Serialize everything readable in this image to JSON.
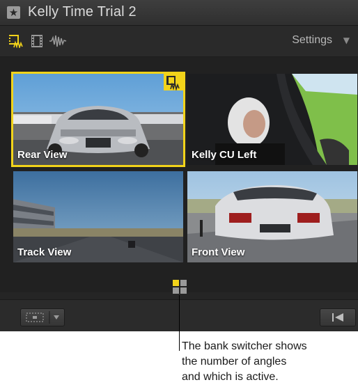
{
  "window": {
    "title": "Kelly Time Trial 2"
  },
  "toolbar": {
    "icons": [
      "video-and-audio-icon",
      "video-only-icon",
      "audio-only-icon"
    ],
    "settings_label": "Settings"
  },
  "angles": [
    {
      "label": "Rear View",
      "active": true
    },
    {
      "label": "Kelly CU Left",
      "active": false
    },
    {
      "label": "Track View",
      "active": false
    },
    {
      "label": "Front View",
      "active": false
    }
  ],
  "bank_switcher": {
    "banks": 4,
    "active_bank": 1
  },
  "colors": {
    "accent": "#f2d31a",
    "background": "#252525"
  },
  "callout": {
    "lines": [
      "The bank switcher shows",
      "the number of angles",
      "and which is active."
    ]
  }
}
